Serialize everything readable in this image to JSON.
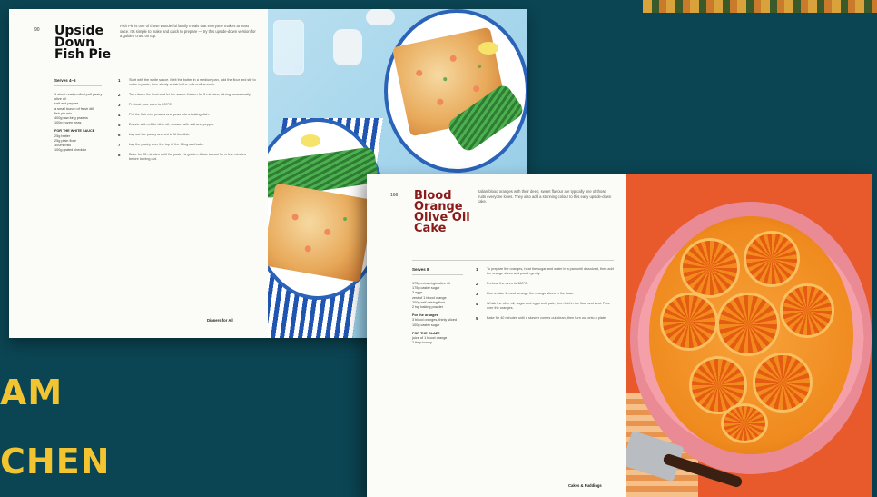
{
  "headlines": [
    "AM",
    "CHEN"
  ],
  "book1": {
    "page_number": "90",
    "title": "Upside Down Fish Pie",
    "intro": "Fish Pie is one of those wonderful family meals that everyone makes at least once. It's simple to make and quick to prepare — try this upside-down version for a golden crust on top.",
    "serves": "Serves 4–6",
    "ingredients": [
      "1 sheet ready-rolled puff pastry",
      "olive oil",
      "salt and pepper",
      "a small bunch of fresh dill",
      "fish pie mix",
      "400g raw king prawns",
      "100g frozen peas"
    ],
    "sauce_heading": "FOR THE WHITE SAUCE",
    "sauce_ingredients": [
      "25g butter",
      "25g plain flour",
      "300ml milk",
      "100g grated cheddar"
    ],
    "steps": [
      {
        "n": "1",
        "text": "Start with the white sauce. Melt the butter in a medium pan, add the flour and stir to make a paste, then slowly whisk in the milk until smooth."
      },
      {
        "n": "2",
        "text": "Turn down the heat and let the sauce thicken for 3 minutes, stirring occasionally."
      },
      {
        "n": "3",
        "text": "Preheat your oven to 200°C."
      },
      {
        "n": "4",
        "text": "Put the fish mix, prawns and peas into a baking dish."
      },
      {
        "n": "5",
        "text": "Drizzle with a little olive oil, season with salt and pepper."
      },
      {
        "n": "6",
        "text": "Lay out the pastry and cut to fit the dish."
      },
      {
        "n": "7",
        "text": "Lay the pastry over the top of the filling and bake."
      },
      {
        "n": "8",
        "text": "Bake for 25 minutes until the pastry is golden. Allow to cool for a few minutes before turning out."
      }
    ],
    "footer": "Dinners for All"
  },
  "book2": {
    "page_number": "166",
    "title": "Blood Orange Olive Oil Cake",
    "intro": "Italian blood oranges with their deep, sweet flavour are typically one of those fruits everyone loves. They also add a stunning colour to this easy upside-down cake.",
    "serves": "Serves 8",
    "ingredients": [
      "175g extra virgin olive oil",
      "175g caster sugar",
      "3 eggs",
      "zest of 1 blood orange",
      "200g self-raising flour",
      "2 tsp baking powder"
    ],
    "oranges_heading": "For the oranges",
    "oranges_ingredients": [
      "3 blood oranges, thinly sliced",
      "100g caster sugar"
    ],
    "glaze_heading": "FOR THE GLAZE",
    "glaze_ingredients": [
      "juice of 1 blood orange",
      "2 tbsp honey"
    ],
    "steps": [
      {
        "n": "1",
        "text": "To prepare the oranges, heat the sugar and water in a pan until dissolved, then add the orange slices and poach gently."
      },
      {
        "n": "2",
        "text": "Preheat the oven to 180°C."
      },
      {
        "n": "3",
        "text": "Line a cake tin and arrange the orange slices in the base."
      },
      {
        "n": "4",
        "text": "Whisk the olive oil, sugar and eggs until pale, then fold in the flour and zest. Pour over the oranges."
      },
      {
        "n": "5",
        "text": "Bake for 40 minutes until a skewer comes out clean, then turn out onto a plate."
      }
    ],
    "footer": "Cakes & Puddings"
  }
}
